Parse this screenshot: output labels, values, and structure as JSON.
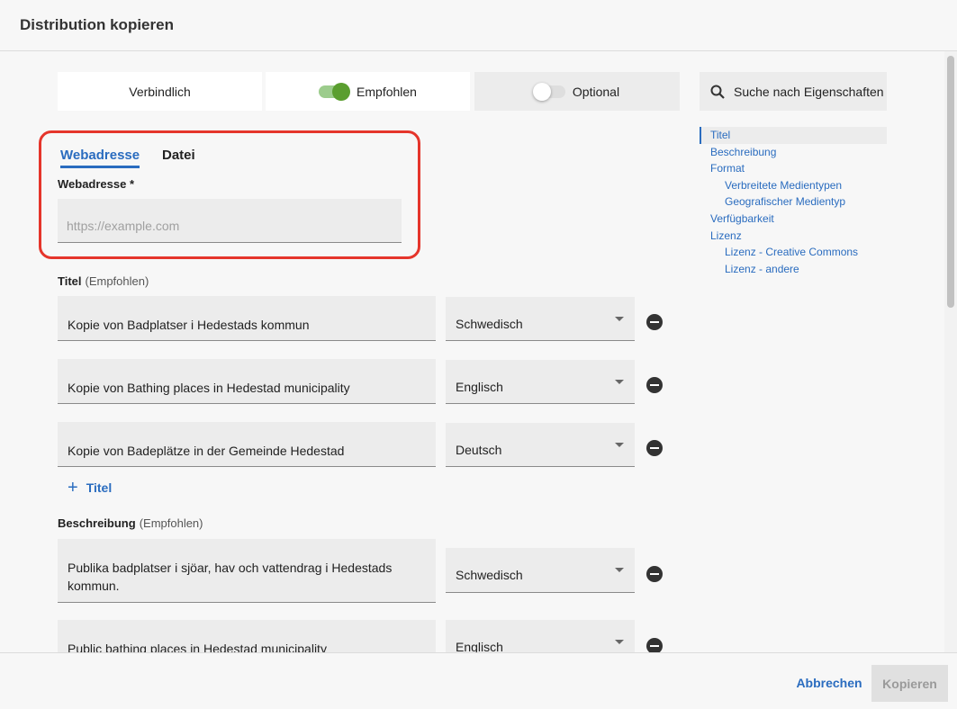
{
  "dialog": {
    "title": "Distribution kopieren"
  },
  "levels": {
    "mandatory": "Verbindlich",
    "recommended": "Empfohlen",
    "optional": "Optional"
  },
  "search": {
    "label": "Suche nach Eigenschaften",
    "icon": "search-icon"
  },
  "toc": [
    {
      "label": "Titel",
      "sub": false,
      "active": true
    },
    {
      "label": "Beschreibung",
      "sub": false,
      "active": false
    },
    {
      "label": "Format",
      "sub": false,
      "active": false
    },
    {
      "label": "Verbreitete Medientypen",
      "sub": true,
      "active": false
    },
    {
      "label": "Geografischer Medientyp",
      "sub": true,
      "active": false
    },
    {
      "label": "Verfügbarkeit",
      "sub": false,
      "active": false
    },
    {
      "label": "Lizenz",
      "sub": false,
      "active": false
    },
    {
      "label": "Lizenz - Creative Commons",
      "sub": true,
      "active": false
    },
    {
      "label": "Lizenz - andere",
      "sub": true,
      "active": false
    }
  ],
  "tabs": {
    "web": "Webadresse",
    "file": "Datei"
  },
  "webaddress": {
    "label": "Webadresse *",
    "placeholder": "https://example.com",
    "value": ""
  },
  "title_section": {
    "label": "Titel",
    "hint": "(Empfohlen)",
    "rows": [
      {
        "text": "Kopie von Badplatser i Hedestads kommun",
        "lang": "Schwedisch"
      },
      {
        "text": "Kopie von Bathing places in Hedestad municipality",
        "lang": "Englisch"
      },
      {
        "text": "Kopie von Badeplätze in der Gemeinde Hedestad",
        "lang": "Deutsch"
      }
    ],
    "add_label": "Titel"
  },
  "description_section": {
    "label": "Beschreibung",
    "hint": "(Empfohlen)",
    "rows": [
      {
        "text": "Publika badplatser i sjöar, hav och vattendrag i Hedestads kommun.",
        "lang": "Schwedisch"
      },
      {
        "text": "Public bathing places in Hedestad municipality",
        "lang": "Englisch"
      }
    ]
  },
  "footer": {
    "cancel": "Abbrechen",
    "copy": "Kopieren"
  },
  "colors": {
    "accent": "#2a6cbf",
    "toggle_on": "#5a9e2f",
    "highlight": "#e5352b"
  }
}
